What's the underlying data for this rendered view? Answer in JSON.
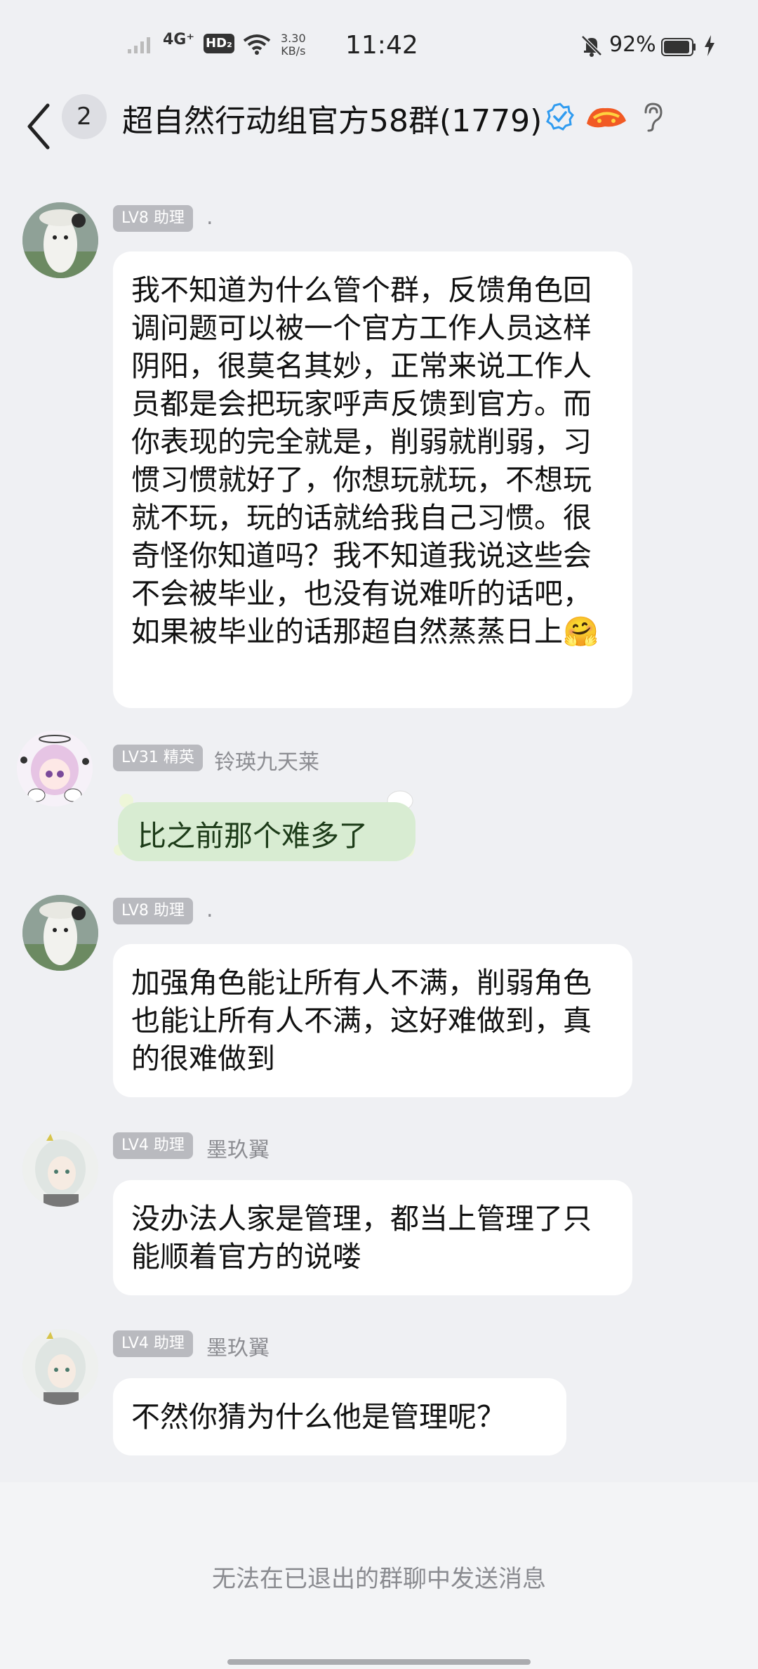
{
  "status_bar": {
    "network": "4G⁺",
    "hd": "HD₂",
    "speed_value": "3.30",
    "speed_unit": "KB/s",
    "time": "11:42",
    "battery": "92%"
  },
  "header": {
    "unread_count": "2",
    "group_title": "超自然行动组官方58群(1779)"
  },
  "messages": [
    {
      "level": "LV8 助理",
      "nickname": ".",
      "text": "我不知道为什么管个群，反馈角色回调问题可以被一个官方工作人员这样阴阳，很莫名其妙，正常来说工作人员都是会把玩家呼声反馈到官方。而你表现的完全就是，削弱就削弱，习惯习惯就好了，你想玩就玩，不想玩就不玩，玩的话就给我自己习惯。很奇怪你知道吗？我不知道我说这些会不会被毕业，也没有说难听的话吧，如果被毕业的话那超自然蒸蒸日上🤗"
    },
    {
      "level": "LV31 精英",
      "nickname": "铃瑛九天莱",
      "text": "比之前那个难多了"
    },
    {
      "level": "LV8 助理",
      "nickname": ".",
      "text": "加强角色能让所有人不满，削弱角色也能让所有人不满，这好难做到，真的很难做到"
    },
    {
      "level": "LV4 助理",
      "nickname": "墨玖翼",
      "text": "没办法人家是管理，都当上管理了只能顺着官方的说喽"
    },
    {
      "level": "LV4 助理",
      "nickname": "墨玖翼",
      "text": "不然你猜为什么他是管理呢？"
    }
  ],
  "footer": {
    "notice": "无法在已退出的群聊中发送消息"
  },
  "colors": {
    "background": "#eff0f3",
    "bubble": "#ffffff",
    "level_badge": "#b9babf",
    "sticker_bubble": "#d8ecd2",
    "verified": "#2f9bf0"
  }
}
